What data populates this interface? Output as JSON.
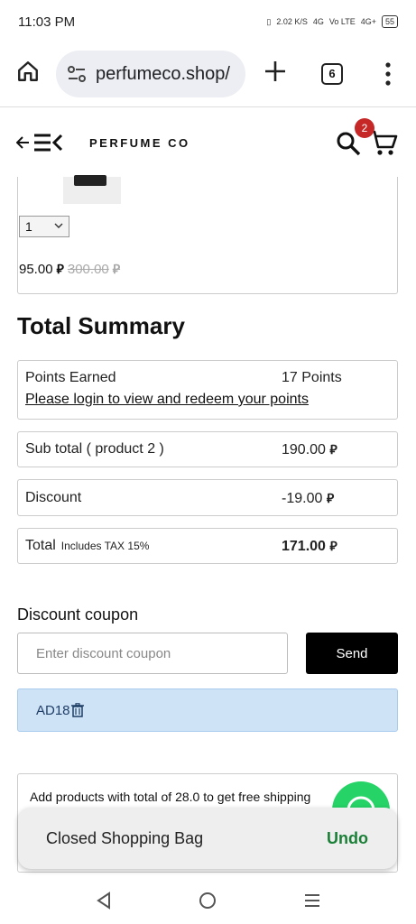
{
  "status": {
    "time": "11:03 PM",
    "speed": "2.02 K/S",
    "net1": "4G",
    "net2": "Vo LTE",
    "net3": "4G+",
    "battery": "55"
  },
  "browser": {
    "url": "perfumeco.shop/",
    "tab_count": "6"
  },
  "header": {
    "brand": "PERFUME CO",
    "cart_count": "2"
  },
  "product": {
    "quantity": "1",
    "price": "95.00",
    "old_price": "300.00",
    "currency_glyph": "⃁"
  },
  "summary": {
    "title": "Total Summary",
    "points_label": "Points Earned",
    "points_value": "17 Points",
    "login_link": "Please login to view and redeem your points",
    "subtotal_label": "Sub total ( product 2 )",
    "subtotal_value": "190.00",
    "discount_label": "Discount",
    "discount_value": "-19.00",
    "total_label": "Total",
    "tax_note": "Includes TAX 15%",
    "total_value": "171.00"
  },
  "coupon": {
    "title": "Discount coupon",
    "placeholder": "Enter discount coupon",
    "send_label": "Send",
    "applied_code": "AD18"
  },
  "shipping": {
    "message": "Add products with total of 28.0 to get free shipping"
  },
  "toast": {
    "message": "Closed Shopping Bag",
    "action": "Undo"
  },
  "colors": {
    "accent_green": "#1a7f37",
    "badge_red": "#c62828",
    "applied_bg": "#cfe3f7",
    "whatsapp": "#25d366"
  }
}
